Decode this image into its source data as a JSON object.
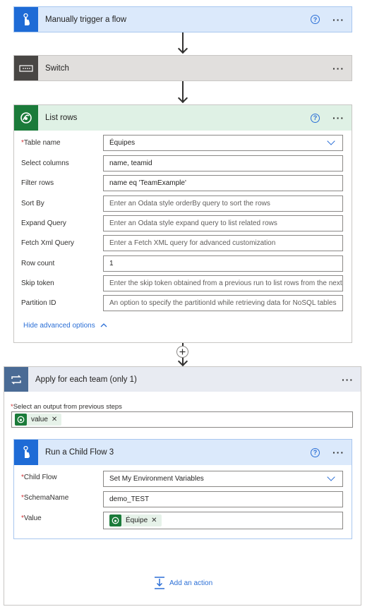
{
  "steps": {
    "trigger": {
      "title": "Manually trigger a flow",
      "help": "?",
      "more": "···"
    },
    "switch": {
      "title": "Switch",
      "more": "···"
    },
    "list_rows": {
      "title": "List rows",
      "help": "?",
      "more": "···",
      "fields": {
        "table_name": {
          "label": "Table name",
          "value": "Équipes"
        },
        "select_columns": {
          "label": "Select columns",
          "value": "name, teamid"
        },
        "filter_rows": {
          "label": "Filter rows",
          "value": "name eq 'TeamExample'"
        },
        "sort_by": {
          "label": "Sort By",
          "placeholder": "Enter an Odata style orderBy query to sort the rows"
        },
        "expand_query": {
          "label": "Expand Query",
          "placeholder": "Enter an Odata style expand query to list related rows"
        },
        "fetch_xml": {
          "label": "Fetch Xml Query",
          "placeholder": "Enter a Fetch XML query for advanced customization"
        },
        "row_count": {
          "label": "Row count",
          "value": "1"
        },
        "skip_token": {
          "label": "Skip token",
          "placeholder": "Enter the skip token obtained from a previous run to list rows from the next pa"
        },
        "partition_id": {
          "label": "Partition ID",
          "placeholder": "An option to specify the partitionId while retrieving data for NoSQL tables"
        }
      },
      "hide_advanced": "Hide advanced options"
    },
    "apply_each": {
      "title": "Apply for each team (only 1)",
      "more": "···",
      "select_label": "Select an output from previous steps",
      "token": "value",
      "child_flow": {
        "title": "Run a Child Flow 3",
        "help": "?",
        "more": "···",
        "fields": {
          "child_flow": {
            "label": "Child Flow",
            "value": "Set My Environment Variables"
          },
          "schema_name": {
            "label": "SchemaName",
            "value": "demo_TEST"
          },
          "value": {
            "label": "Value",
            "token": "Équipe"
          }
        }
      },
      "add_action": "Add an action"
    }
  },
  "colors": {
    "trigger_header": "#dbe9fb",
    "trigger_icon": "#1e6bd6",
    "switch_header": "#e1dfdd",
    "switch_icon": "#484644",
    "dataverse_header": "#dff1e5",
    "dataverse_icon": "#1b7b3a",
    "apply_header": "#e8ebf2",
    "apply_icon": "#4a6b95",
    "link": "#2b6fd6",
    "required": "#d13438"
  }
}
